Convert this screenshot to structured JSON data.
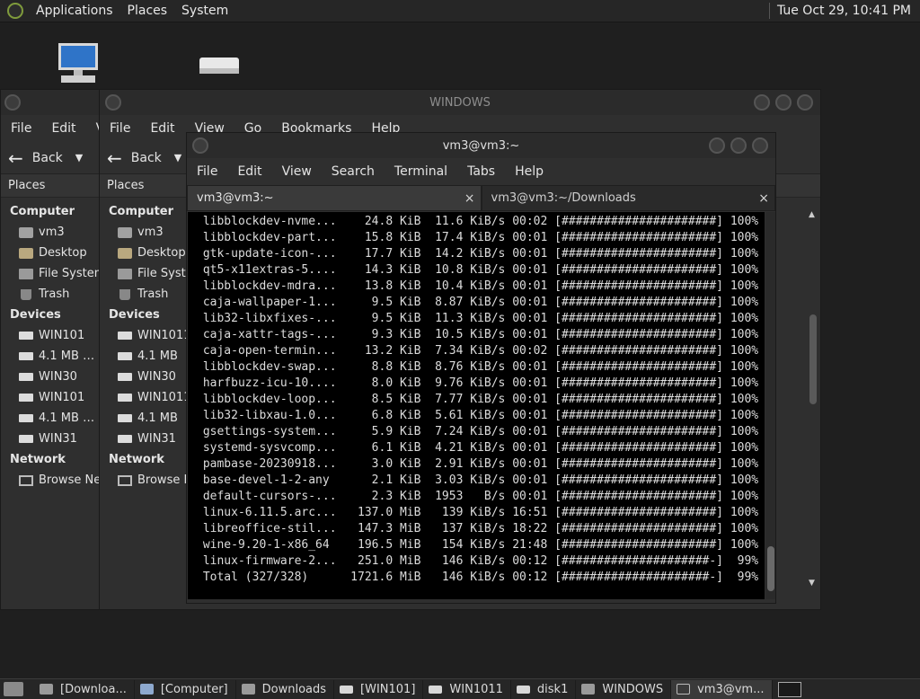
{
  "top_panel": {
    "menus": [
      "Applications",
      "Places",
      "System"
    ],
    "clock": "Tue Oct 29, 10:41 PM"
  },
  "desktop_icons": [
    "computer-icon",
    "drive-icon"
  ],
  "file_manager_back": {
    "menu": [
      "File",
      "Edit",
      "Vi"
    ],
    "back_label": "Back",
    "places_label": "Places",
    "computer_header": "Computer",
    "computer_items": [
      "vm3",
      "Desktop",
      "File System",
      "Trash"
    ],
    "devices_header": "Devices",
    "devices": [
      "WIN101",
      "4.1 MB …",
      "WIN30",
      "WIN101",
      "4.1 MB …",
      "WIN31"
    ],
    "network_header": "Network",
    "network_items": [
      "Browse Network"
    ]
  },
  "file_manager_windows": {
    "title": "WINDOWS",
    "menu": [
      "File",
      "Edit",
      "View",
      "Go",
      "Bookmarks",
      "Help"
    ],
    "back_label": "Back",
    "places_label": "Places",
    "computer_header": "Computer",
    "computer_items": [
      "vm3",
      "Desktop",
      "File System",
      "Trash"
    ],
    "devices_header": "Devices",
    "devices": [
      "WIN1011",
      "4.1 MB",
      "WIN30",
      "WIN1011",
      "4.1 MB",
      "WIN31"
    ],
    "network_header": "Network",
    "network_items": [
      "Browse Network"
    ]
  },
  "terminal": {
    "title": "vm3@vm3:~",
    "menu": [
      "File",
      "Edit",
      "View",
      "Search",
      "Terminal",
      "Tabs",
      "Help"
    ],
    "tabs": [
      {
        "label": "vm3@vm3:~",
        "close": "×"
      },
      {
        "label": "vm3@vm3:~/Downloads",
        "close": "×"
      }
    ],
    "lines": [
      " libblockdev-nvme...    24.8 KiB  11.6 KiB/s 00:02 [######################] 100%",
      " libblockdev-part...    15.8 KiB  17.4 KiB/s 00:01 [######################] 100%",
      " gtk-update-icon-...    17.7 KiB  14.2 KiB/s 00:01 [######################] 100%",
      " qt5-x11extras-5....    14.3 KiB  10.8 KiB/s 00:01 [######################] 100%",
      " libblockdev-mdra...    13.8 KiB  10.4 KiB/s 00:01 [######################] 100%",
      " caja-wallpaper-1...     9.5 KiB  8.87 KiB/s 00:01 [######################] 100%",
      " lib32-libxfixes-...     9.5 KiB  11.3 KiB/s 00:01 [######################] 100%",
      " caja-xattr-tags-...     9.3 KiB  10.5 KiB/s 00:01 [######################] 100%",
      " caja-open-termin...    13.2 KiB  7.34 KiB/s 00:02 [######################] 100%",
      " libblockdev-swap...     8.8 KiB  8.76 KiB/s 00:01 [######################] 100%",
      " harfbuzz-icu-10....     8.0 KiB  9.76 KiB/s 00:01 [######################] 100%",
      " libblockdev-loop...     8.5 KiB  7.77 KiB/s 00:01 [######################] 100%",
      " lib32-libxau-1.0...     6.8 KiB  5.61 KiB/s 00:01 [######################] 100%",
      " gsettings-system...     5.9 KiB  7.24 KiB/s 00:01 [######################] 100%",
      " systemd-sysvcomp...     6.1 KiB  4.21 KiB/s 00:01 [######################] 100%",
      " pambase-20230918...     3.0 KiB  2.91 KiB/s 00:01 [######################] 100%",
      " base-devel-1-2-any      2.1 KiB  3.03 KiB/s 00:01 [######################] 100%",
      " default-cursors-...     2.3 KiB  1953   B/s 00:01 [######################] 100%",
      " linux-6.11.5.arc...   137.0 MiB   139 KiB/s 16:51 [######################] 100%",
      " libreoffice-stil...   147.3 MiB   137 KiB/s 18:22 [######################] 100%",
      " wine-9.20-1-x86_64    196.5 MiB   154 KiB/s 21:48 [######################] 100%",
      " linux-firmware-2...   251.0 MiB   146 KiB/s 00:12 [#####################-]  99%",
      " Total (327/328)      1721.6 MiB   146 KiB/s 00:12 [#####################-]  99%"
    ]
  },
  "taskbar": {
    "items": [
      {
        "label": "[Downloa...",
        "icon": "folder-icon"
      },
      {
        "label": "[Computer]",
        "icon": "computer-icon"
      },
      {
        "label": "Downloads",
        "icon": "folder-icon"
      },
      {
        "label": "[WIN101]",
        "icon": "drive-icon"
      },
      {
        "label": "WIN1011",
        "icon": "drive-icon"
      },
      {
        "label": "disk1",
        "icon": "drive-icon"
      },
      {
        "label": "WINDOWS",
        "icon": "folder-icon"
      },
      {
        "label": "vm3@vm...",
        "icon": "terminal-icon"
      }
    ]
  }
}
